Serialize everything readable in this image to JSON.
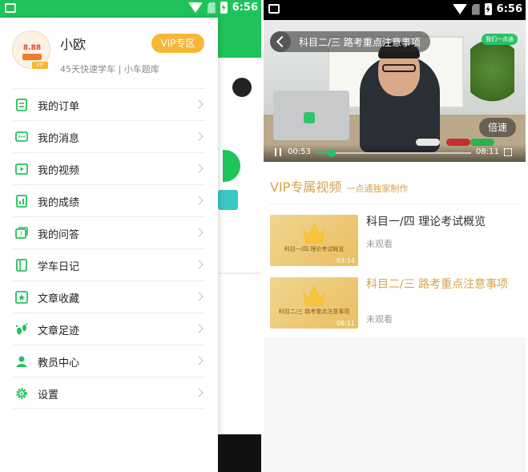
{
  "status_bar": {
    "time": "6:56"
  },
  "drawer": {
    "username": "小欧",
    "subtitle": "45天快速学车 | 小车题库",
    "vip_button": "VIP专区",
    "avatar_amount": "8.88",
    "avatar_vip": "VIP",
    "menu": [
      {
        "label": "我的订单",
        "icon": "order-icon"
      },
      {
        "label": "我的消息",
        "icon": "message-icon"
      },
      {
        "label": "我的视频",
        "icon": "video-icon"
      },
      {
        "label": "我的成绩",
        "icon": "score-icon"
      },
      {
        "label": "我的问答",
        "icon": "qa-icon"
      },
      {
        "label": "学车日记",
        "icon": "diary-icon"
      },
      {
        "label": "文章收藏",
        "icon": "star-icon"
      },
      {
        "label": "文章足迹",
        "icon": "footprint-icon"
      },
      {
        "label": "教员中心",
        "icon": "user-icon"
      },
      {
        "label": "设置",
        "icon": "gear-icon"
      }
    ],
    "accent_color": "#20c35a"
  },
  "player": {
    "title": "科目二/三 路考重点注意事项",
    "brand": "我们一点通",
    "speed_label": "倍速",
    "current_time": "00:53",
    "total_time": "08:11",
    "progress": 0.11
  },
  "vip": {
    "title": "VIP专属视频",
    "subtitle": "一点通独家制作",
    "accent_color": "#d9a24b",
    "videos": [
      {
        "title": "科目一/四 理论考试概览",
        "thumb_caption": "科目一/四 理论考试概览",
        "duration": "03:14",
        "status": "未观看",
        "active": false
      },
      {
        "title": "科目二/三 路考重点注意事项",
        "thumb_caption": "科目二/三 路考重点注意事项",
        "duration": "08:11",
        "status": "未观看",
        "active": true
      }
    ]
  }
}
